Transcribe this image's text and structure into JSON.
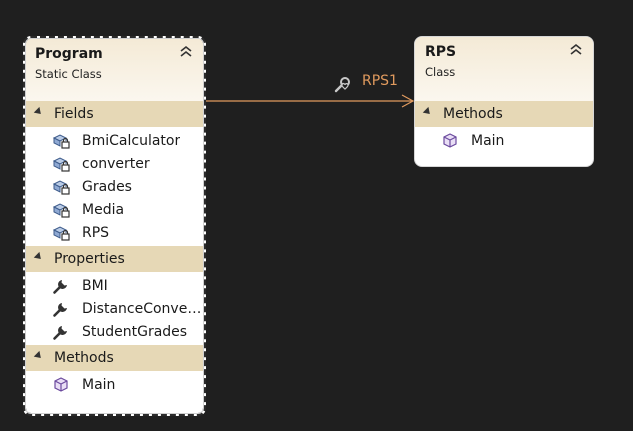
{
  "program": {
    "name": "Program",
    "stereotype": "Static Class",
    "sections": [
      {
        "title": "Fields",
        "items": [
          {
            "label": "BmiCalculator",
            "icon": "field-lock-icon"
          },
          {
            "label": "converter",
            "icon": "field-lock-icon"
          },
          {
            "label": "Grades",
            "icon": "field-lock-icon"
          },
          {
            "label": "Media",
            "icon": "field-lock-icon"
          },
          {
            "label": "RPS",
            "icon": "field-lock-icon"
          }
        ]
      },
      {
        "title": "Properties",
        "items": [
          {
            "label": "BMI",
            "icon": "wrench-icon"
          },
          {
            "label": "DistanceConver...",
            "icon": "wrench-icon"
          },
          {
            "label": "StudentGrades",
            "icon": "wrench-icon"
          }
        ]
      },
      {
        "title": "Methods",
        "items": [
          {
            "label": "Main",
            "icon": "method-cube-icon"
          }
        ]
      }
    ]
  },
  "rps": {
    "name": "RPS",
    "stereotype": "Class",
    "sections": [
      {
        "title": "Methods",
        "items": [
          {
            "label": "Main",
            "icon": "method-cube-icon"
          }
        ]
      }
    ]
  },
  "association": {
    "label": "RPS1",
    "icon": "wrench-heart-icon",
    "color": "#e09a5e"
  },
  "colors": {
    "background": "#1f1f1f",
    "section_header": "#e6d8b6",
    "header_gradient_top": "#f4ead6"
  }
}
